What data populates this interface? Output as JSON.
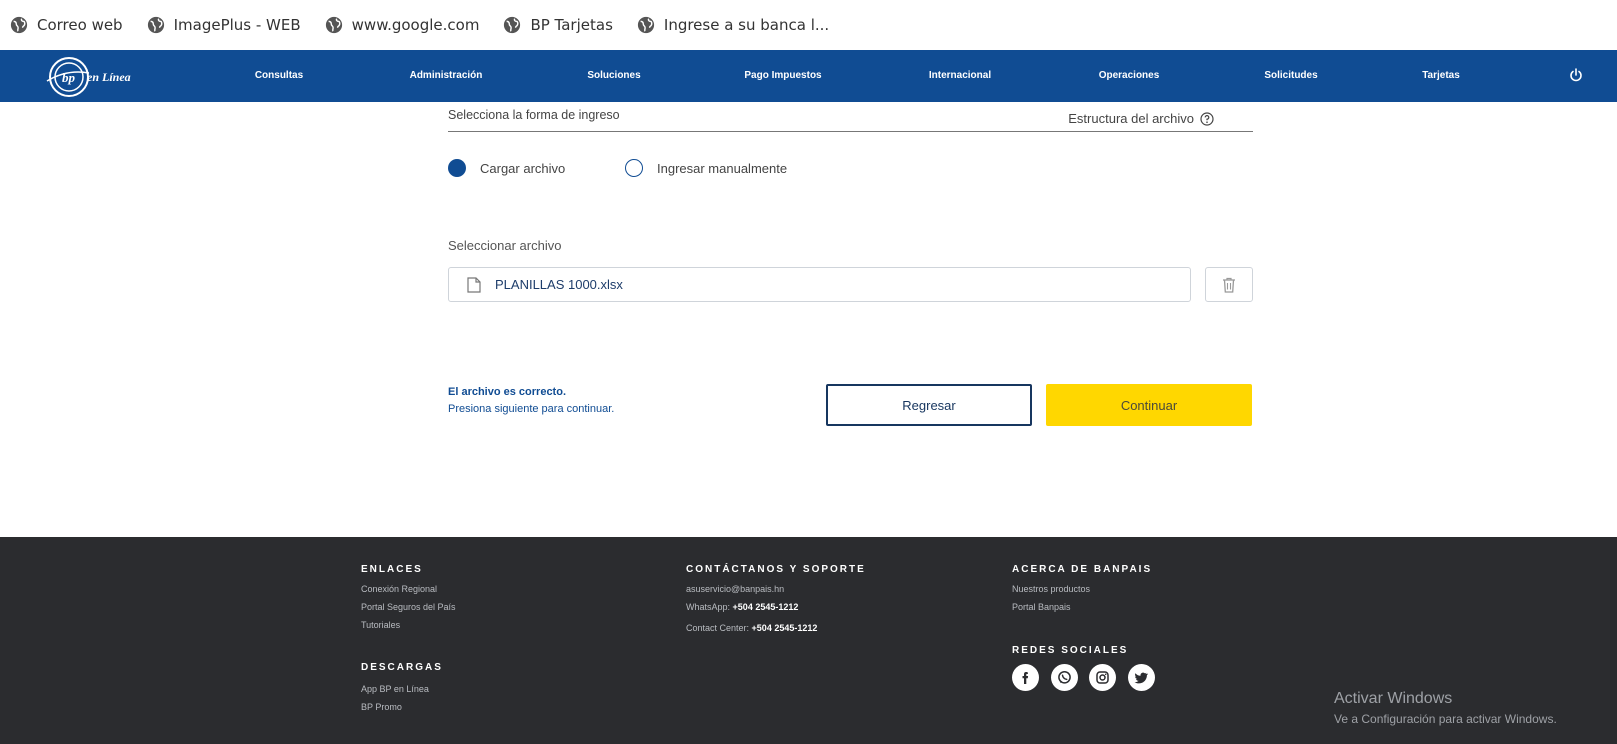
{
  "bookmarks": [
    {
      "label": "Correo web",
      "icon": "globe-icon"
    },
    {
      "label": "ImagePlus - WEB",
      "icon": "globe-icon"
    },
    {
      "label": "www.google.com",
      "icon": "globe-icon"
    },
    {
      "label": "BP Tarjetas",
      "icon": "globe-icon"
    },
    {
      "label": "Ingrese a su banca l...",
      "icon": "globe-icon"
    }
  ],
  "nav": {
    "logo_text": "en Línea",
    "logo_mark": "bp",
    "items": [
      "Consultas",
      "Administración",
      "Soluciones",
      "Pago Impuestos",
      "Internacional",
      "Operaciones",
      "Solicitudes",
      "Tarjetas"
    ]
  },
  "form": {
    "section_title": "Selecciona la forma de ingreso",
    "structure_link": "Estructura del archivo",
    "radio_upload": "Cargar archivo",
    "radio_manual": "Ingresar manualmente",
    "selected": "Cargar archivo",
    "file_label": "Seleccionar archivo",
    "file_name": "PLANILLAS 1000.xlsx",
    "status_line1": "El archivo es correcto.",
    "status_line2": "Presiona siguiente para continuar.",
    "back_button": "Regresar",
    "continue_button": "Continuar"
  },
  "footer": {
    "enlaces": {
      "title": "ENLACES",
      "items": [
        "Conexión Regional",
        "Portal Seguros del País",
        "Tutoriales"
      ]
    },
    "descargas": {
      "title": "DESCARGAS",
      "items": [
        "App BP en Línea",
        "BP Promo"
      ]
    },
    "contacto": {
      "title": "CONTÁCTANOS Y SOPORTE",
      "email": "asuservicio@banpais.hn",
      "whatsapp_label": "WhatsApp:",
      "whatsapp_number": "+504 2545-1212",
      "contact_label": "Contact Center:",
      "contact_number": "+504 2545-1212"
    },
    "acerca": {
      "title": "ACERCA DE BANPAIS",
      "items": [
        "Nuestros productos",
        "Portal Banpais"
      ]
    },
    "redes": {
      "title": "REDES SOCIALES",
      "icons": [
        "facebook-icon",
        "whatsapp-icon",
        "instagram-icon",
        "twitter-icon"
      ]
    }
  },
  "watermark": {
    "line1": "Activar Windows",
    "line2": "Ve a Configuración para activar Windows."
  },
  "colors": {
    "nav_blue": "#104c93",
    "accent_yellow": "#ffd700",
    "footer_bg": "#2b2c2f"
  }
}
